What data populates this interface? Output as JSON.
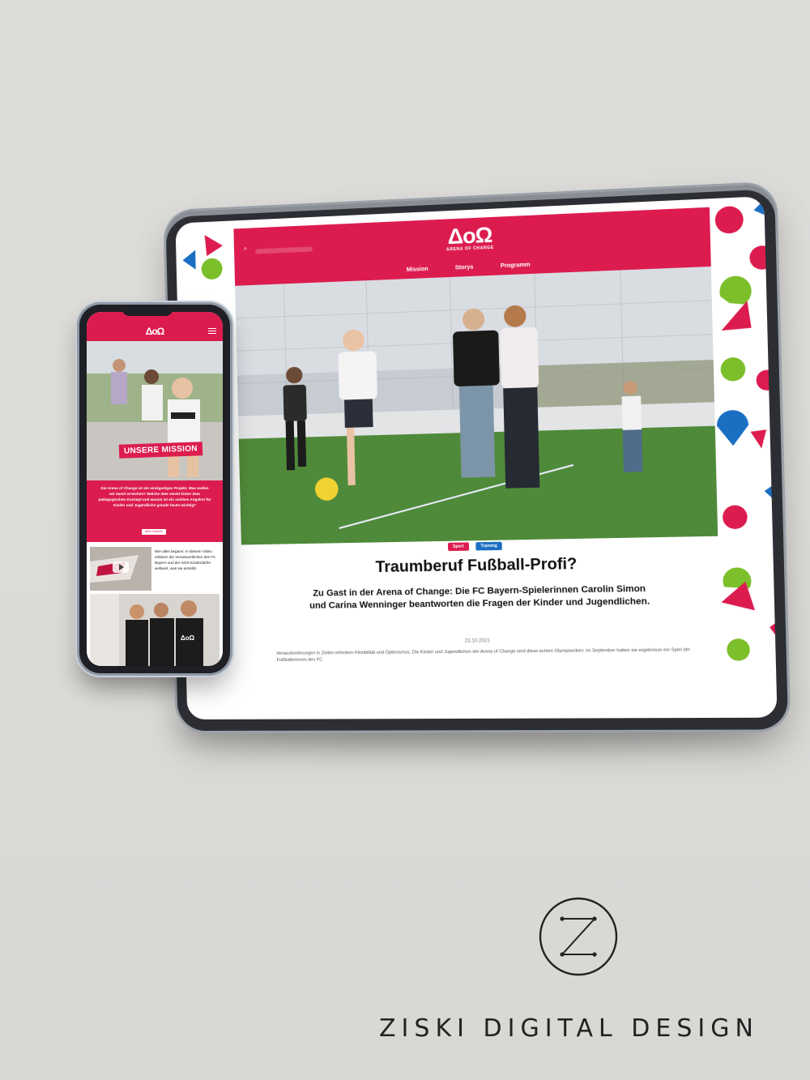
{
  "tablet": {
    "search_icon": "search-icon",
    "logo_mark": "ΔoΩ",
    "logo_sub": "ARENA OF CHANGE",
    "nav": [
      "Mission",
      "Storys",
      "Programm"
    ],
    "tags": [
      "Sport",
      "Training"
    ],
    "title": "Traumberuf Fußball-Profi?",
    "subtitle": "Zu Gast in der Arena of Change: Die FC Bayern-Spielerinnen Carolin Simon und Carina Wenninger beantworten die Fragen der Kinder und Jugendlichen.",
    "date": "23.10.2021",
    "body": "Herausforderungen in Zeiten erfordern Flexibilität und Optimismus. Die Kinder und Jugendlichen der Arena of Change sind diese echten Olympioniken: im September hatten sie ergebnisse ein Spiel der Fußballerinnen des FC"
  },
  "phone": {
    "logo_mark": "ΔoΩ",
    "mission_label": "UNSERE MISSION",
    "intro_text": "Die Arena of Change ist ein einzigartiges Projekt. Was wollen wir damit erreichen? Welche Idee steckt hinter dem pädagogischen Konzept und warum ist ein solches Angebot für Kinder und Jugendliche gerade heute wichtig?",
    "intro_button": "Mehr erfahren",
    "video_text": "Wie alles begann: In diesem Video erklären die Verantwortlichen des FC Bayern und der SOS-Kinderdörfer weltweit, was sie antreibt.",
    "shirt_logo": "ΔoΩ"
  },
  "brand": {
    "mark_letter": "Z",
    "name": "ZISKI DIGITAL DESIGN"
  },
  "colors": {
    "brand_red": "#dc1c4f",
    "accent_blue": "#1b6fc2",
    "accent_green": "#7bbf2a"
  }
}
